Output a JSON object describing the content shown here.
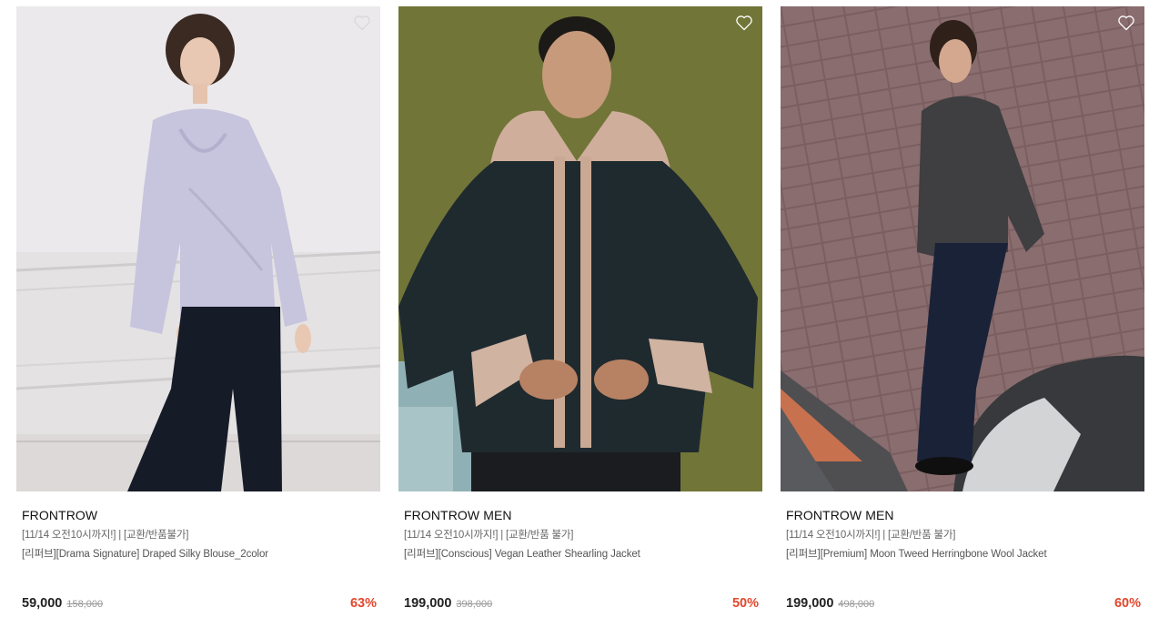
{
  "products": [
    {
      "brand": "FRONTROW",
      "promo": "[11/14 오전10시까지!] | [교환/반품불가]",
      "name": "[리퍼브][Drama Signature] Draped Silky Blouse_2color",
      "price": "59,000",
      "original_price": "158,000",
      "discount": "63%",
      "wishlist_icon": "heart-outline-icon"
    },
    {
      "brand": "FRONTROW MEN",
      "promo": "[11/14 오전10시까지!] | [교환/반품 불가]",
      "name": "[리퍼브][Conscious] Vegan Leather Shearling Jacket",
      "price": "199,000",
      "original_price": "398,000",
      "discount": "50%",
      "wishlist_icon": "heart-outline-icon"
    },
    {
      "brand": "FRONTROW MEN",
      "promo": "[11/14 오전10시까지!] | [교환/반품 불가]",
      "name": "[리퍼브][Premium] Moon Tweed Herringbone Wool Jacket",
      "price": "199,000",
      "original_price": "498,000",
      "discount": "60%",
      "wishlist_icon": "heart-outline-icon"
    }
  ],
  "colors": {
    "discount": "#e2472c",
    "price": "#222222",
    "original_price": "#999999"
  }
}
